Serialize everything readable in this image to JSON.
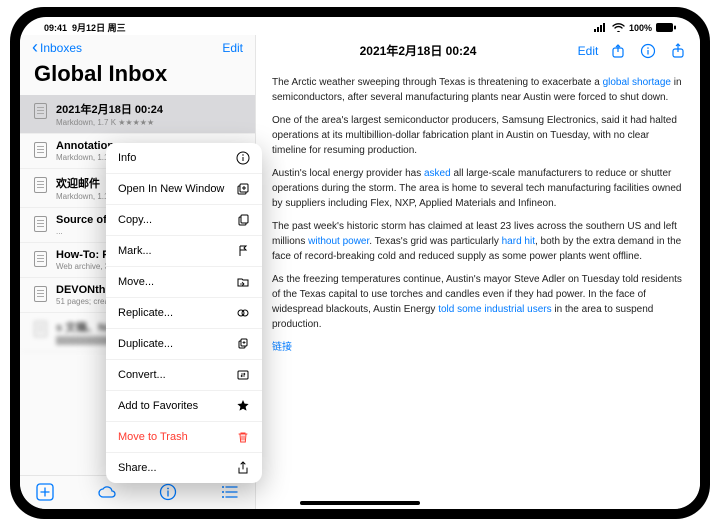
{
  "status": {
    "time": "09:41",
    "date": "9月12日 周三",
    "signal": "•••",
    "wifi": "wifi",
    "battery": "100%"
  },
  "left": {
    "back": "Inboxes",
    "edit": "Edit",
    "title": "Global Inbox",
    "items": [
      {
        "title": "2021年2月18日 00:24",
        "meta": "Markdown, 1.7 K ★★★★★"
      },
      {
        "title": "Annotations",
        "meta": "Markdown, 1.1 K ★★★★★"
      },
      {
        "title": "欢迎邮件",
        "meta": "Markdown, 1.1 K ★★★★★"
      },
      {
        "title": "Source of https://web.archive.com/... u=9344ae9",
        "meta": "..."
      },
      {
        "title": "How-To: Pus",
        "meta": "Web archive, 36..."
      },
      {
        "title": "DEVONthi",
        "meta": "51 pages; createc"
      },
      {
        "title": "s 文稿、Numbers 表格和 Keynote",
        "meta": ""
      }
    ]
  },
  "menu": [
    {
      "label": "Info",
      "icon": "info"
    },
    {
      "label": "Open In New Window",
      "icon": "newwin"
    },
    {
      "label": "Copy...",
      "icon": "copy"
    },
    {
      "label": "Mark...",
      "icon": "flag"
    },
    {
      "label": "Move...",
      "icon": "move"
    },
    {
      "label": "Replicate...",
      "icon": "replicate"
    },
    {
      "label": "Duplicate...",
      "icon": "duplicate"
    },
    {
      "label": "Convert...",
      "icon": "convert"
    },
    {
      "label": "Add to Favorites",
      "icon": "star"
    },
    {
      "label": "Move to Trash",
      "icon": "trash",
      "danger": true
    },
    {
      "label": "Share...",
      "icon": "share"
    }
  ],
  "right": {
    "edit": "Edit",
    "title": "2021年2月18日 00:24",
    "paragraphs": [
      {
        "pre": "The Arctic weather sweeping through Texas is threatening to exacerbate a ",
        "link": "global shortage",
        "post": " in semiconductors, after several manufacturing plants near Austin were forced to shut down."
      },
      {
        "pre": "One of the area's largest semiconductor producers, Samsung Electronics, said it had halted operations at its multibillion-dollar fabrication plant in Austin on Tuesday, with no clear timeline for resuming production.",
        "link": "",
        "post": ""
      },
      {
        "pre": "Austin's local energy provider has ",
        "link": "asked",
        "post": " all large-scale manufacturers to reduce or shutter operations during the storm. The area is home to several tech manufacturing facilities owned by suppliers including Flex, NXP, Applied Materials and Infineon."
      },
      {
        "pre": "The past week's historic storm has claimed at least 23 lives across the southern US and left millions ",
        "link": "without power",
        "post": ". Texas's grid was particularly ",
        "link2": "hard hit",
        "post2": ", both by the extra demand in the face of record-breaking cold and reduced supply as some power plants went offline."
      },
      {
        "pre": "As the freezing temperatures continue, Austin's mayor Steve Adler on Tuesday told residents of the Texas capital to use torches and candles even if they had power. In the face of widespread blackouts, Austin Energy ",
        "link": "told some industrial users",
        "post": " in the area to suspend production."
      },
      {
        "pre": "",
        "link": "链接",
        "post": ""
      }
    ]
  }
}
